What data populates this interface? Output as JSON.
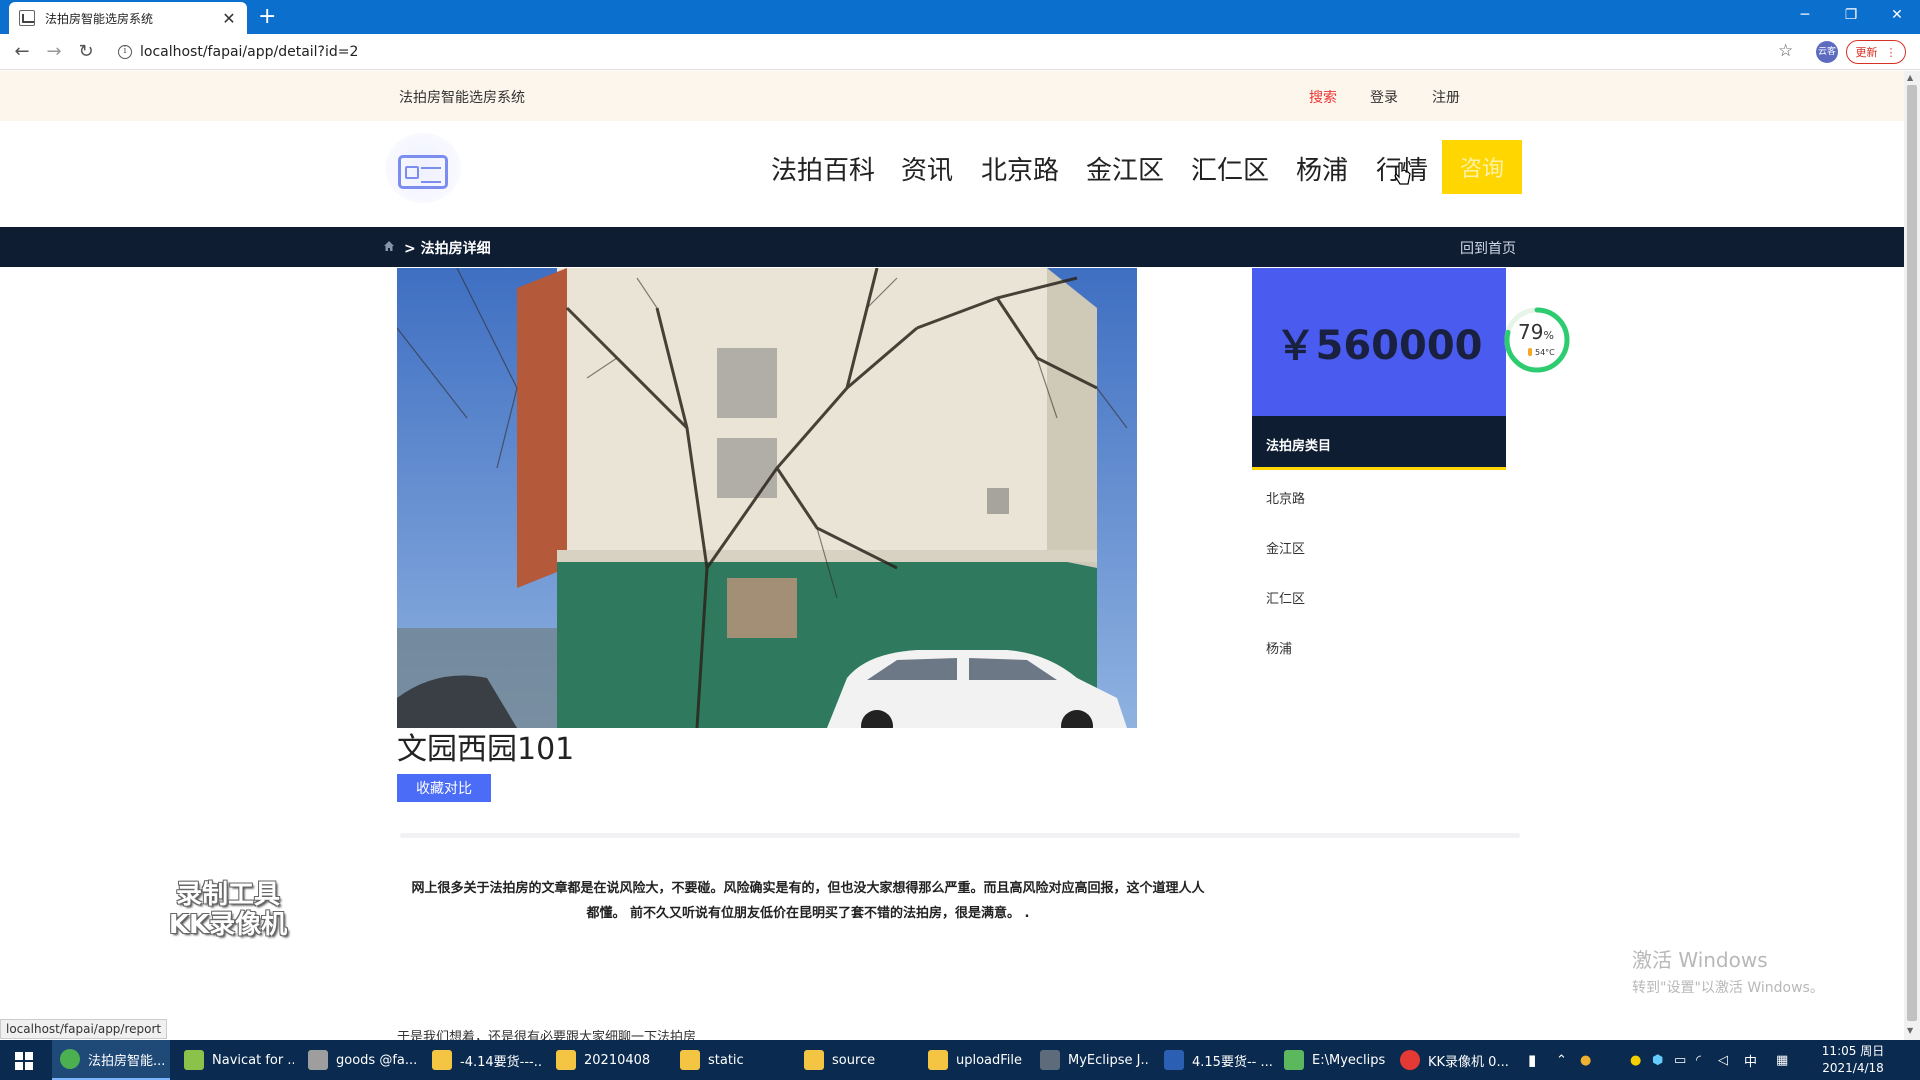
{
  "browser": {
    "tab_title": "法拍房智能选房系统",
    "new_tab": "+",
    "url": "localhost/fapai/app/detail?id=2",
    "profile_label": "云客",
    "update_label": "更新",
    "status_url": "localhost/fapai/app/report"
  },
  "site": {
    "name": "法拍房智能选房系统",
    "top_links": [
      "搜索",
      "登录",
      "注册"
    ]
  },
  "nav": {
    "items": [
      "法拍百科",
      "资讯",
      "北京路",
      "金江区",
      "汇仁区",
      "杨浦",
      "行情"
    ],
    "highlight": "咨询"
  },
  "breadcrumb": {
    "current": "> 法拍房详细",
    "back_home": "回到首页"
  },
  "property": {
    "title": "文园西园101",
    "favorite_button": "收藏对比",
    "price": "￥560000",
    "description": "网上很多关于法拍房的文章都是在说风险大，不要碰。风险确实是有的，但也没大家想得那么严重。而且高风险对应高回报，这个道理人人都懂。 前不久又听说有位朋友低价在昆明买了套不错的法拍房，很是满意。 .",
    "more_text": "于是我们想着，还是很有必要跟大家细聊一下法拍房"
  },
  "categories": {
    "heading": "法拍房类目",
    "items": [
      "北京路",
      "金江区",
      "汇仁区",
      "杨浦"
    ]
  },
  "gauge": {
    "percent": "79",
    "unit": "%",
    "temp": "54°C",
    "fraction": 0.79
  },
  "overlay": {
    "watermark_line1": "录制工具",
    "watermark_line2": "KK录像机",
    "activate_line1": "激活 Windows",
    "activate_line2": "转到\"设置\"以激活 Windows。"
  },
  "taskbar": {
    "items": [
      {
        "label": "法拍房智能...",
        "icon": "chrome-icon",
        "color": "#4caf50"
      },
      {
        "label": "Navicat for ...",
        "icon": "navicat-icon",
        "color": "#8bc34a"
      },
      {
        "label": "goods @fa...",
        "icon": "database-icon",
        "color": "#9e9e9e"
      },
      {
        "label": "-4.14要货---...",
        "icon": "folder-icon",
        "color": "#f4c542"
      },
      {
        "label": "20210408",
        "icon": "folder-icon",
        "color": "#f4c542"
      },
      {
        "label": "static",
        "icon": "folder-icon",
        "color": "#f4c542"
      },
      {
        "label": "source",
        "icon": "folder-icon",
        "color": "#f4c542"
      },
      {
        "label": "uploadFile",
        "icon": "folder-icon",
        "color": "#f4c542"
      },
      {
        "label": "MyEclipse J...",
        "icon": "eclipse-icon",
        "color": "#5d6b7a"
      },
      {
        "label": "4.15要货-- ...",
        "icon": "word-icon",
        "color": "#2b5fb4"
      },
      {
        "label": "E:\\Myeclips...",
        "icon": "notepad-icon",
        "color": "#5cb85c"
      },
      {
        "label": "KK录像机 0...",
        "icon": "kk-icon",
        "color": "#e53935"
      }
    ],
    "ime": "中",
    "time": "11:05 周日",
    "date": "2021/4/18"
  }
}
